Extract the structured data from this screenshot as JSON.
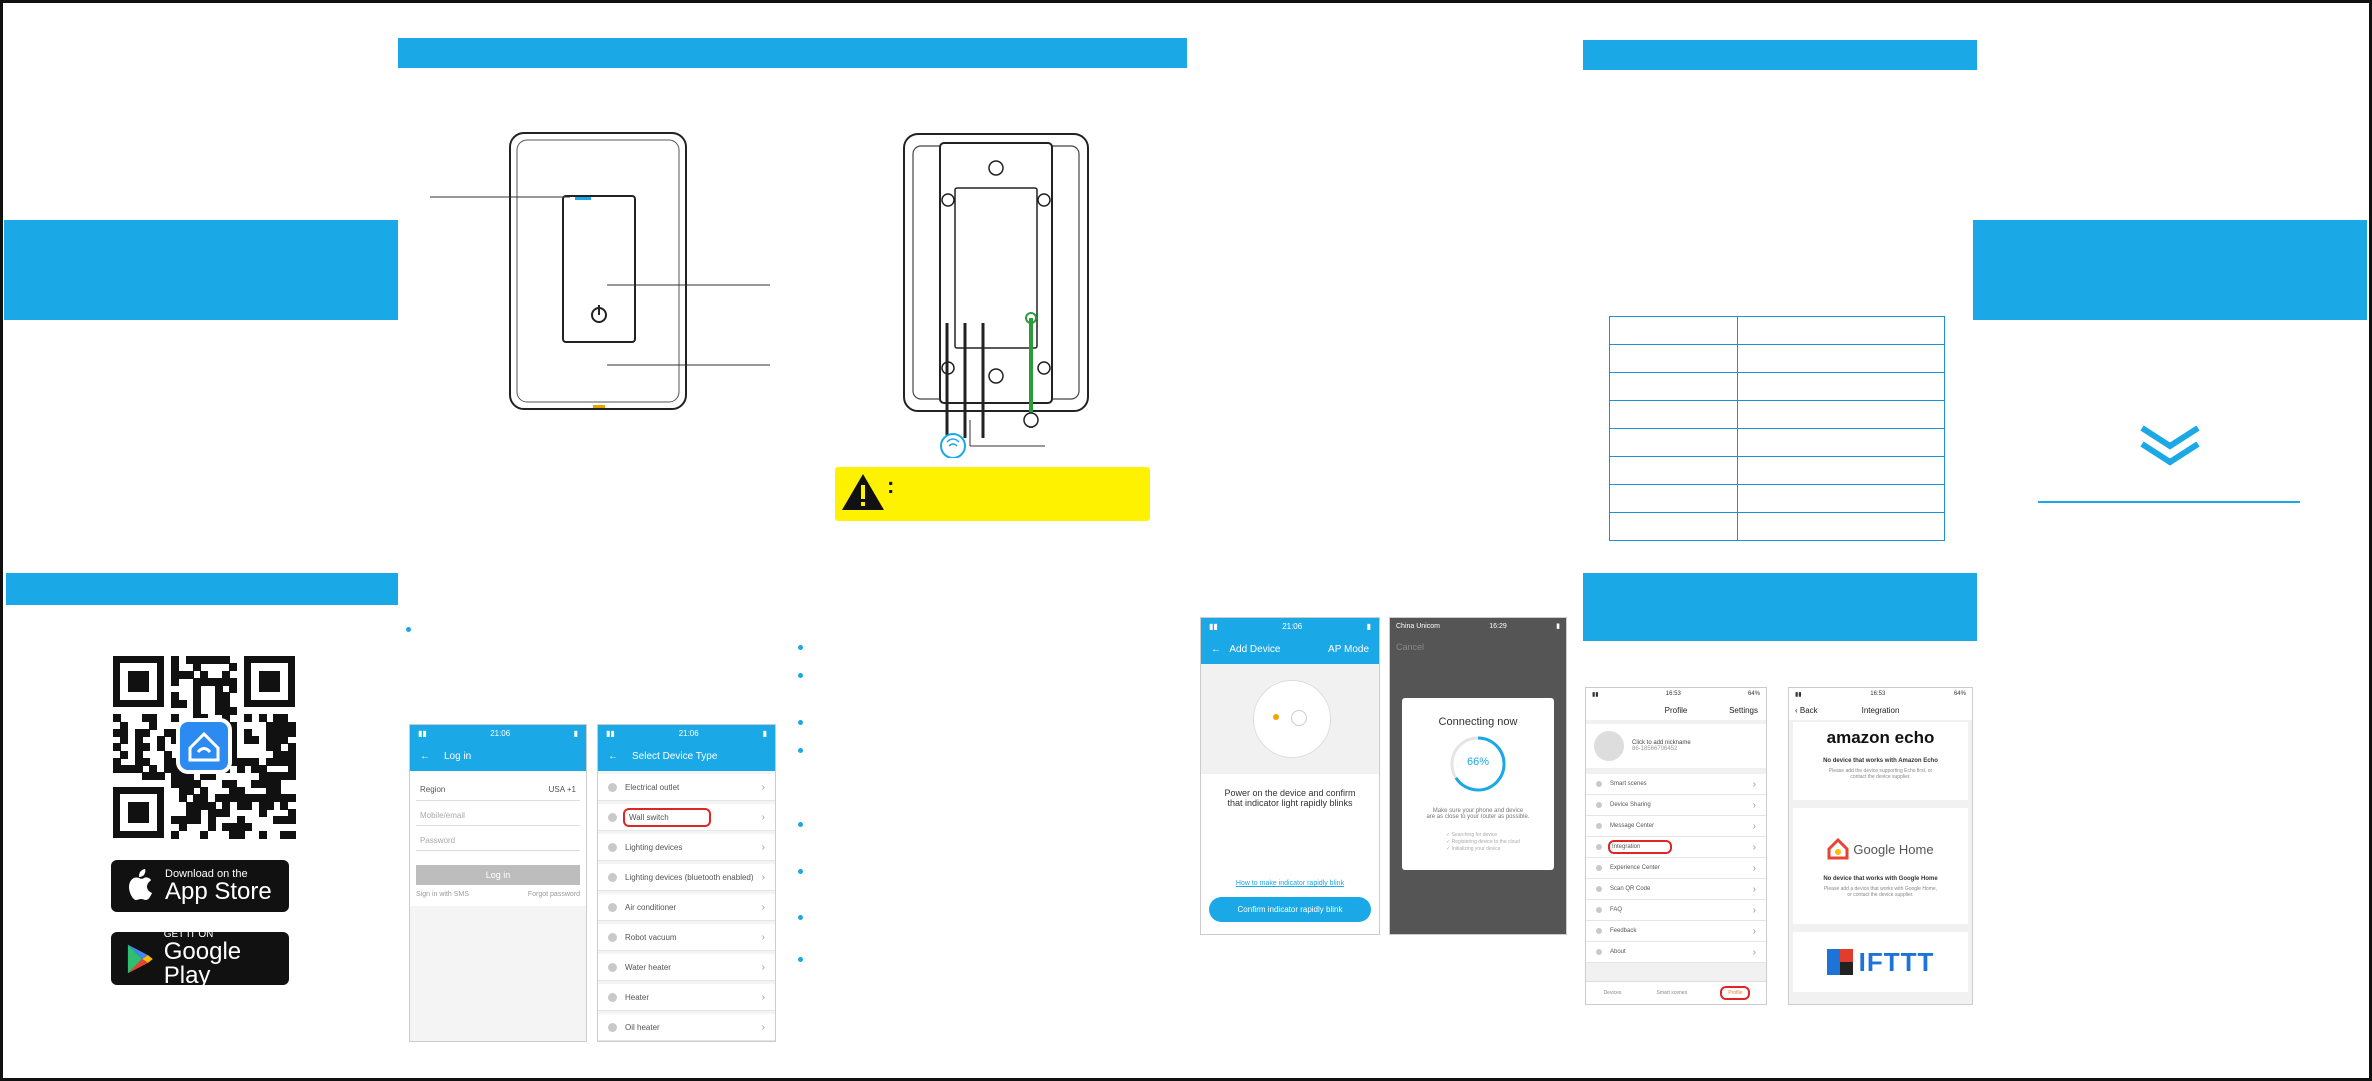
{
  "colors": {
    "accent": "#1ba8e6",
    "warning": "#fff200",
    "text": "#222222"
  },
  "badges": {
    "app_store_top": "Download on the",
    "app_store_bottom": "App Store",
    "google_top": "GET IT ON",
    "google_bottom": "Google Play"
  },
  "warning_mark": ":",
  "login_screen": {
    "status_time": "21:06",
    "title": "Log in",
    "region_label": "Region",
    "region_value": "USA +1",
    "account_placeholder": "Mobile/email",
    "password_placeholder": "Password",
    "login_button": "Log in",
    "sms_link": "Sign in with SMS",
    "forgot_link": "Forgot password"
  },
  "device_screen": {
    "status_time": "21:06",
    "title": "Select Device Type",
    "items": [
      "Electrical outlet",
      "Wall switch",
      "Lighting devices",
      "Lighting devices (bluetooth enabled)",
      "Air conditioner",
      "Robot vacuum",
      "Water heater",
      "Heater",
      "Oil heater"
    ]
  },
  "add_device_screen": {
    "status_time": "21:06",
    "title": "Add Device",
    "mode": "AP Mode",
    "instruction_line1": "Power on the device and confirm",
    "instruction_line2": "that indicator light rapidly blinks",
    "help_link": "How to make indicator rapidly blink",
    "confirm_button": "Confirm indicator rapidly blink"
  },
  "connecting_screen": {
    "carrier": "China Unicom",
    "status_time": "16:29",
    "cancel": "Cancel",
    "title": "Connecting now",
    "progress": "66%",
    "progress_value": 0.66,
    "note1": "Make sure your phone and device",
    "note2": "are as close to your router as possible.",
    "step1": "✓ Searching for device",
    "step2": "✓ Registering device to the cloud",
    "step3": "✓ Initializing your device"
  },
  "profile_screen": {
    "status_time": "16:53",
    "battery": "64%",
    "title": "Profile",
    "settings": "Settings",
    "nickname": "Click to add nickname",
    "account": "86-18566706452",
    "items": [
      "Smart scenes",
      "Device Sharing",
      "Message Center",
      "Integration",
      "Experience Center",
      "Scan QR Code",
      "FAQ",
      "Feedback",
      "About"
    ],
    "tabs": [
      "Devices",
      "Smart scenes",
      "Profile"
    ]
  },
  "integration_screen": {
    "status_time": "16:53",
    "battery": "64%",
    "back": "Back",
    "title": "Integration",
    "amazon_logo": "amazon echo",
    "amazon_msg": "No device that works with Amazon Echo",
    "amazon_sub1": "Please add the device supporting Echo first, or",
    "amazon_sub2": "contact the device supplier.",
    "google_logo": "Google Home",
    "google_msg": "No device that works with Google Home",
    "google_sub1": "Please add a device that works with Google Home,",
    "google_sub2": "or contact the device supplier.",
    "ifttt_logo": "IFTTT"
  },
  "spec_table_rows": 8
}
